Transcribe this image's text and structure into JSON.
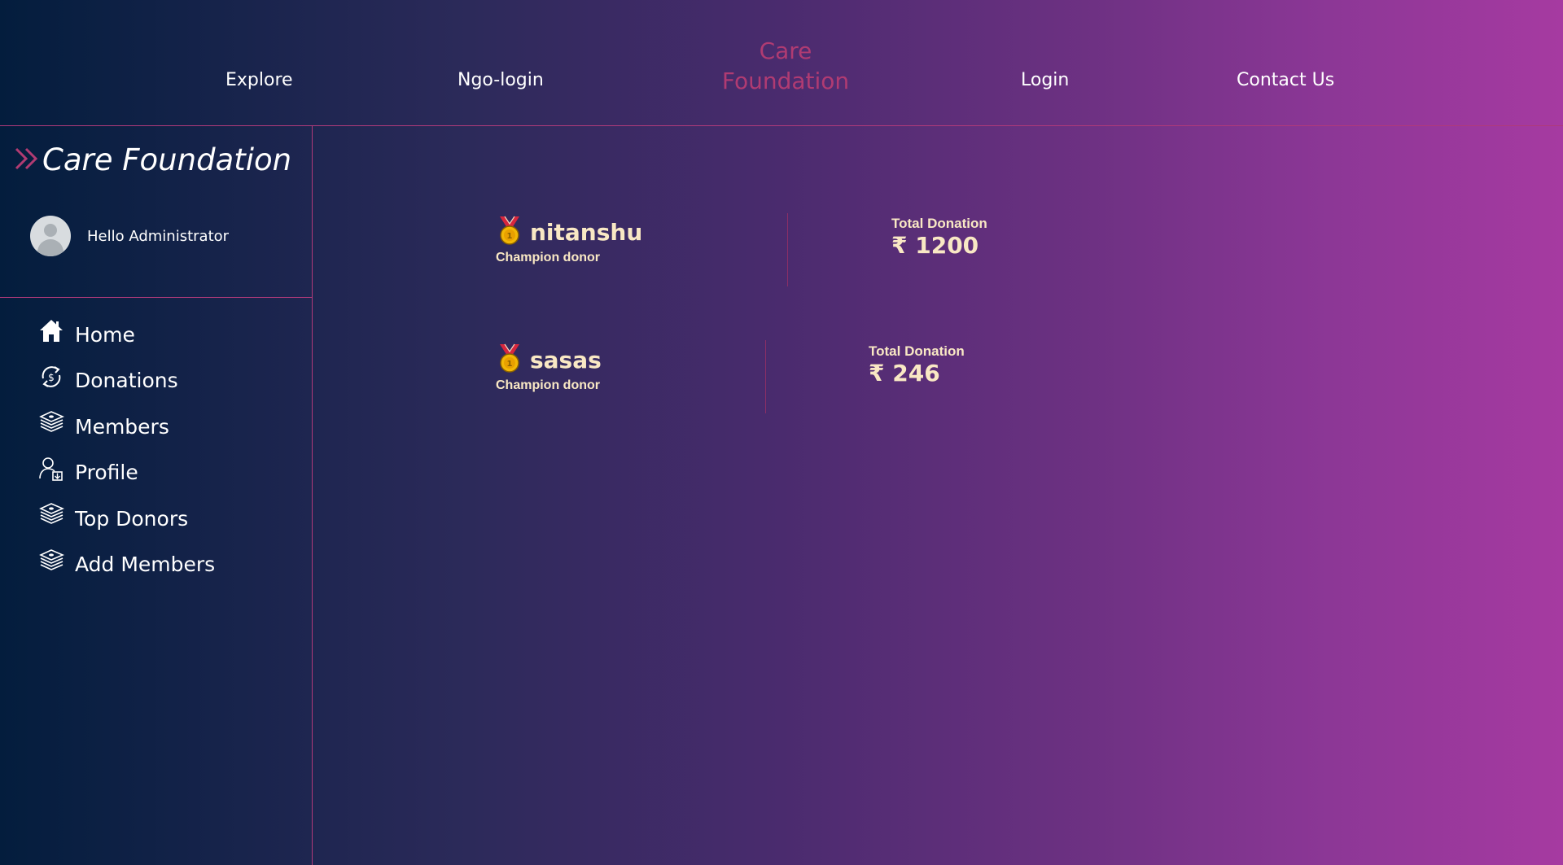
{
  "topnav": {
    "links": [
      "Explore",
      "Ngo-login",
      "Login",
      "Contact Us"
    ],
    "brand_line1": "Care",
    "brand_line2": "Foundation"
  },
  "sidebar": {
    "brand": "Care Foundation",
    "greeting": "Hello Administrator",
    "items": [
      {
        "label": "Home",
        "icon": "home-icon"
      },
      {
        "label": "Donations",
        "icon": "donation-cycle-icon"
      },
      {
        "label": "Members",
        "icon": "money-stack-icon"
      },
      {
        "label": "Profile",
        "icon": "profile-icon"
      },
      {
        "label": "Top Donors",
        "icon": "money-stack-icon"
      },
      {
        "label": "Add Members",
        "icon": "money-stack-icon"
      }
    ]
  },
  "donors": [
    {
      "name": "nitanshu",
      "tag": "Champion donor",
      "total_label": "Total Donation",
      "amount": "₹ 1200"
    },
    {
      "name": "sasas",
      "tag": "Champion donor",
      "total_label": "Total Donation",
      "amount": "₹ 246"
    }
  ],
  "colors": {
    "accent": "#b03b72",
    "donor_text": "#f9e8c4",
    "divider": "#b03a7a"
  }
}
